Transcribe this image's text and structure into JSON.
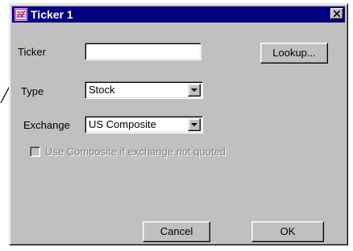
{
  "window": {
    "title": "Ticker 1",
    "app_icon": "ticker-chart-icon",
    "close_icon": "close-icon"
  },
  "form": {
    "ticker_label": "Ticker",
    "ticker_value": "",
    "type_label": "Type",
    "type_value": "Stock",
    "exchange_label": "Exchange",
    "exchange_value": "US Composite",
    "composite_checkbox_label": "Use Composite if exchange not quoted",
    "composite_checked": false
  },
  "buttons": {
    "lookup_label": "Lookup...",
    "cancel_label": "Cancel",
    "ok_label": "OK"
  },
  "colors": {
    "titlebar": "#000080",
    "face": "#c0c0c0",
    "disabled_text": "#808080"
  }
}
